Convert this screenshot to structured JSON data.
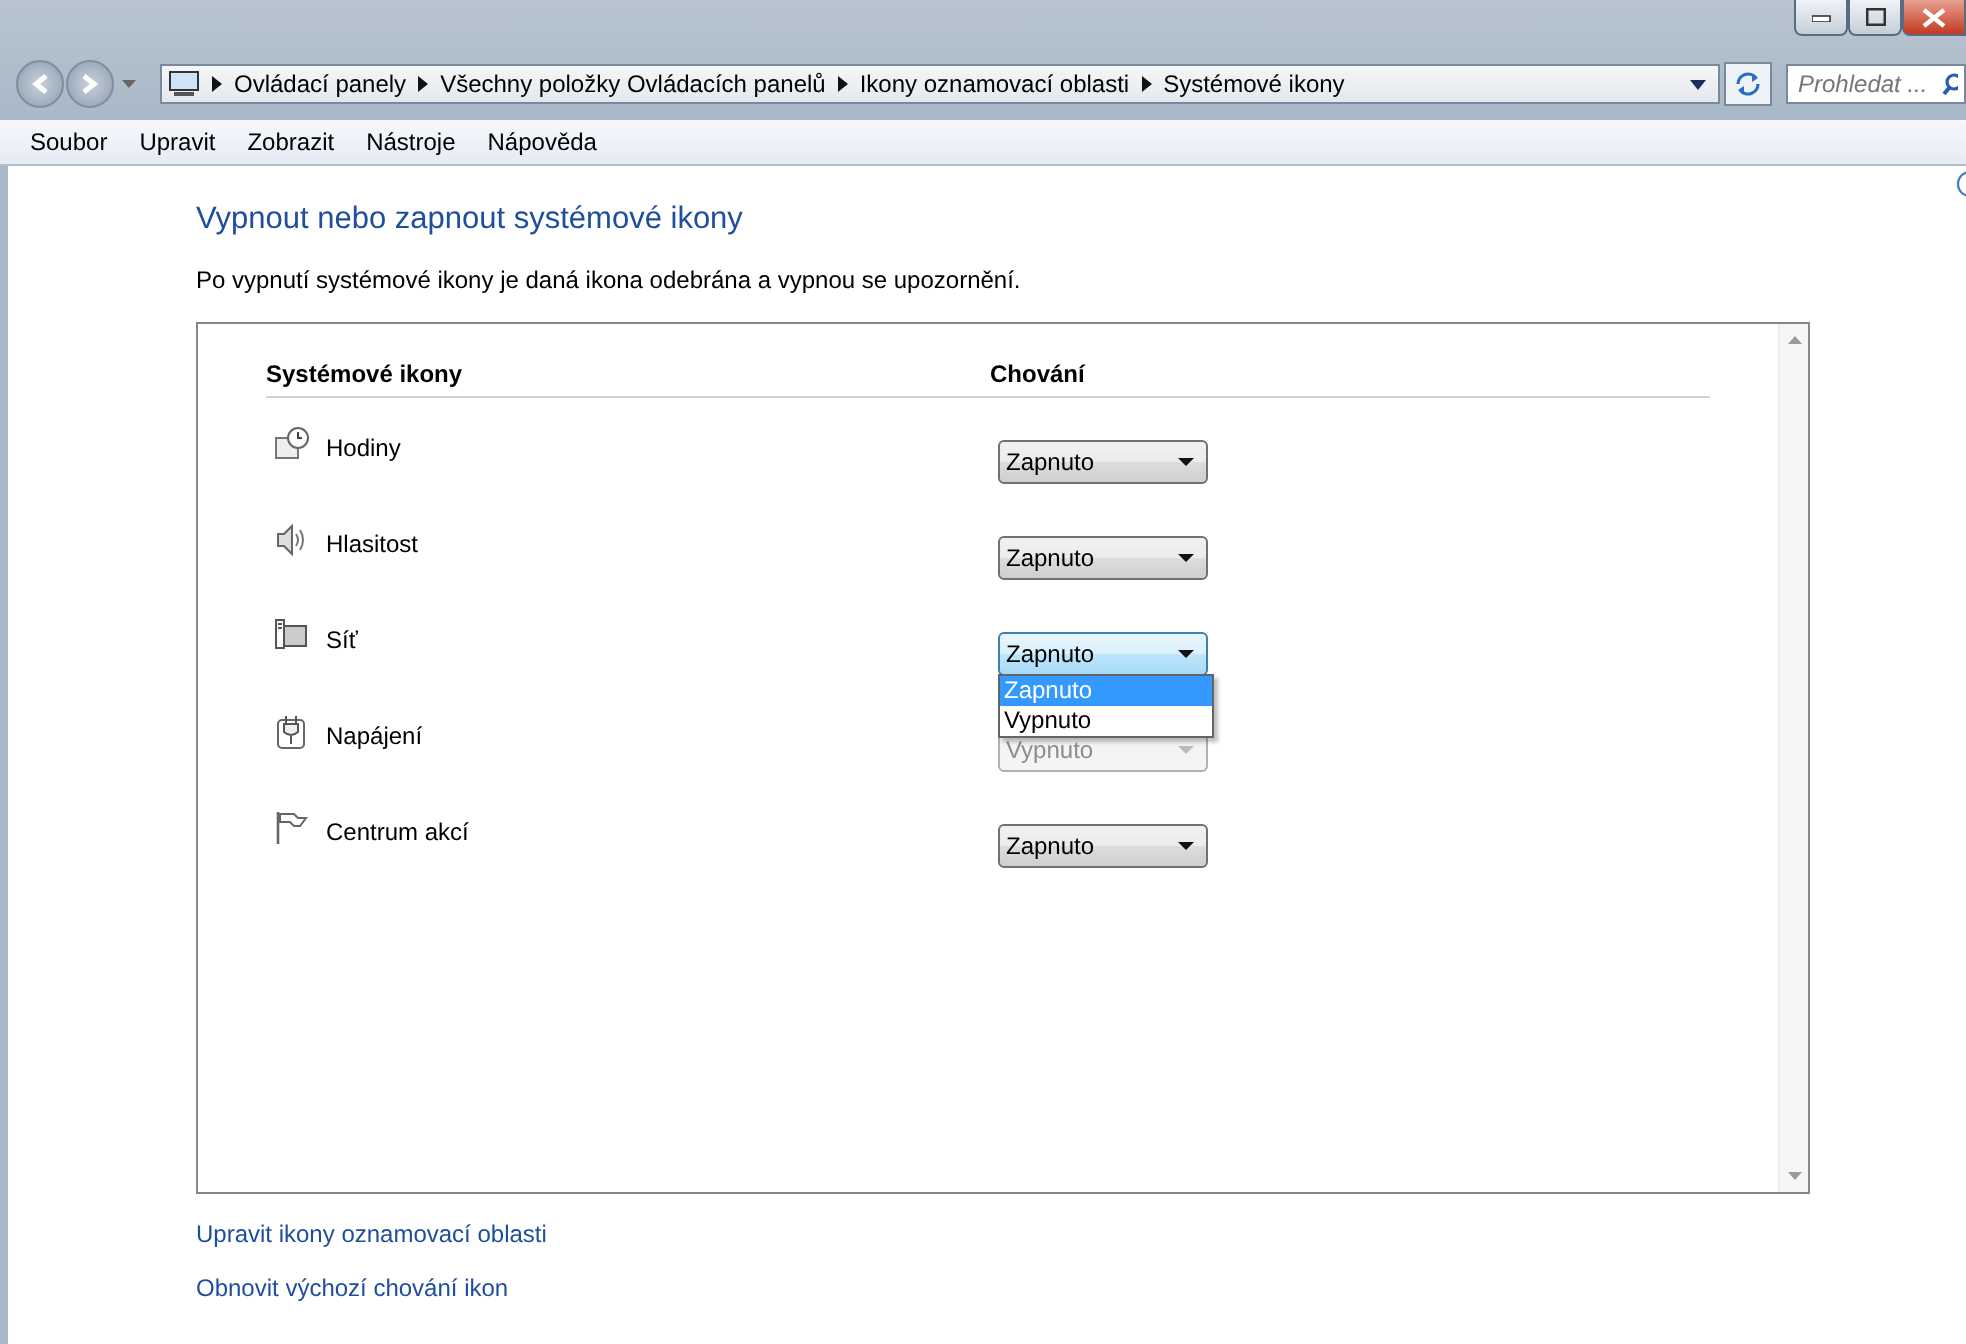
{
  "breadcrumb": [
    "Ovládací panely",
    "Všechny položky Ovládacích panelů",
    "Ikony oznamovací oblasti",
    "Systémové ikony"
  ],
  "search": {
    "placeholder": "Prohledat ..."
  },
  "menu": [
    "Soubor",
    "Upravit",
    "Zobrazit",
    "Nástroje",
    "Nápověda"
  ],
  "title": "Vypnout nebo zapnout systémové ikony",
  "description": "Po vypnutí systémové ikony je daná ikona odebrána a vypnou se upozornění.",
  "table": {
    "columns": [
      "Systémové ikony",
      "Chování"
    ],
    "rows": [
      {
        "kind": "clock",
        "name": "Hodiny",
        "value": "Zapnuto",
        "disabled": false,
        "focused": false
      },
      {
        "kind": "speaker",
        "name": "Hlasitost",
        "value": "Zapnuto",
        "disabled": false,
        "focused": false
      },
      {
        "kind": "network",
        "name": "Síť",
        "value": "Zapnuto",
        "disabled": false,
        "focused": true,
        "options": [
          {
            "label": "Zapnuto",
            "selected": true
          },
          {
            "label": "Vypnuto",
            "selected": false
          }
        ]
      },
      {
        "kind": "power",
        "name": "Napájení",
        "value": "Vypnuto",
        "disabled": true,
        "focused": false
      },
      {
        "kind": "flag",
        "name": "Centrum akcí",
        "value": "Zapnuto",
        "disabled": false,
        "focused": false
      }
    ]
  },
  "links": [
    "Upravit ikony oznamovací oblasti",
    "Obnovit výchozí chování ikon"
  ]
}
